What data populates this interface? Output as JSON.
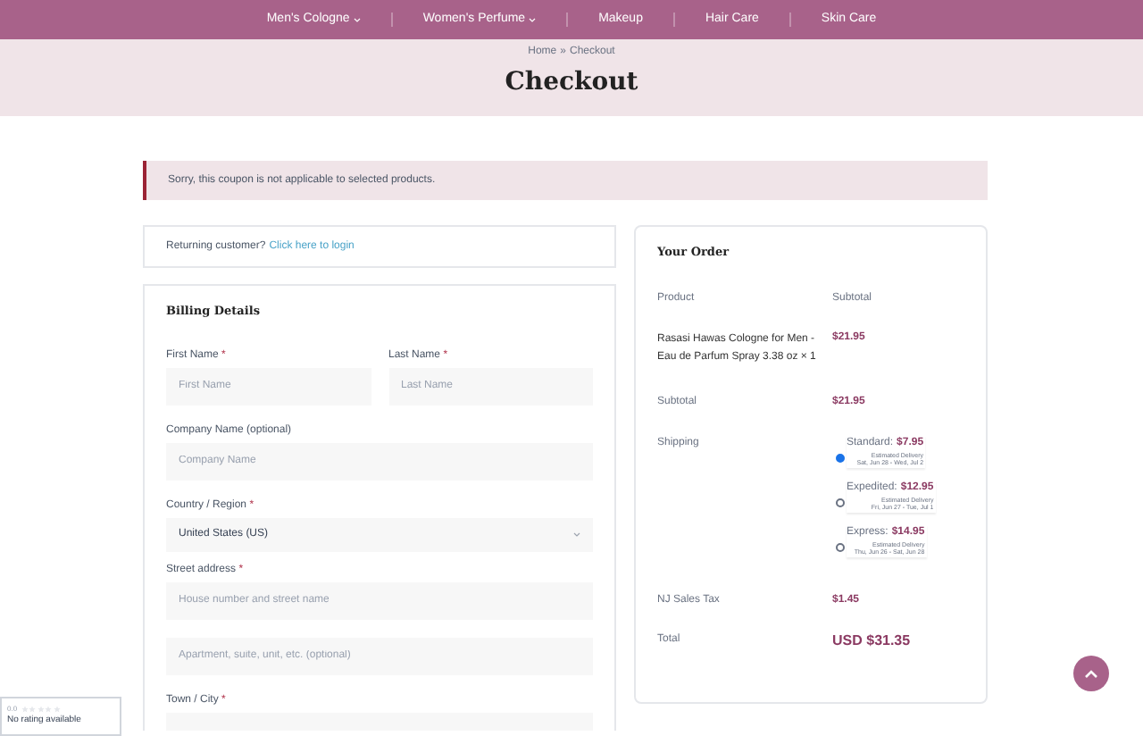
{
  "nav": [
    {
      "label": "Men's Cologne",
      "dropdown": true
    },
    {
      "label": "Women's Perfume",
      "dropdown": true
    },
    {
      "label": "Makeup",
      "dropdown": false
    },
    {
      "label": "Hair Care",
      "dropdown": false
    },
    {
      "label": "Skin Care",
      "dropdown": false
    }
  ],
  "breadcrumb": {
    "home": "Home",
    "separator": "»",
    "current": "Checkout"
  },
  "title": "Checkout",
  "notice": "Sorry, this coupon is not applicable to selected products.",
  "returning": {
    "text": "Returning customer?",
    "link": "Click here to login"
  },
  "billing": {
    "title": "Billing Details",
    "fields": [
      {
        "kind": "half",
        "label": "First Name",
        "required_mark": "*",
        "placeholder": "First Name"
      },
      {
        "kind": "half",
        "label": "Last Name",
        "required_mark": "*",
        "placeholder": "Last Name"
      },
      {
        "kind": "full",
        "label": "Company Name (optional)",
        "placeholder": "Company Name"
      },
      {
        "kind": "select",
        "label": "Country / Region",
        "required_mark": "*",
        "value": "United States (US)"
      },
      {
        "kind": "full",
        "label": "Street address",
        "required_mark": "*",
        "placeholder": "House number and street name"
      },
      {
        "kind": "full",
        "placeholder": "Apartment, suite, unit, etc. (optional)"
      },
      {
        "kind": "full",
        "label": "Town / City",
        "required_mark": "*"
      }
    ]
  },
  "order": {
    "title": "Your Order",
    "columns": [
      "Product",
      "Subtotal"
    ],
    "product": {
      "name": "Rasasi Hawas Cologne for Men - Eau de Parfum Spray 3.38 oz",
      "qty": "× 1",
      "price": "$21.95"
    },
    "subtotal": {
      "label": "Subtotal",
      "value": "$21.95"
    },
    "shipping": {
      "label": "Shipping",
      "options": [
        {
          "name": "Standard:",
          "price": "$7.95",
          "note": "Estimated Delivery",
          "dates": "Sat, Jun 28 - Wed, Jul 2",
          "selected": true
        },
        {
          "name": "Expedited:",
          "price": "$12.95",
          "note": "Estimated Delivery",
          "dates": "Fri, Jun 27 - Tue, Jul 1",
          "selected": false
        },
        {
          "name": "Express:",
          "price": "$14.95",
          "note": "Estimated Delivery",
          "dates": "Thu, Jun 26 - Sat, Jun 28",
          "selected": false
        }
      ]
    },
    "tax": {
      "label": "NJ Sales Tax",
      "value": "$1.45"
    },
    "total": {
      "label": "Total",
      "value": "USD $31.35"
    }
  },
  "rating_widget": {
    "score": "0.0",
    "stars": 0,
    "text": "No rating available"
  }
}
